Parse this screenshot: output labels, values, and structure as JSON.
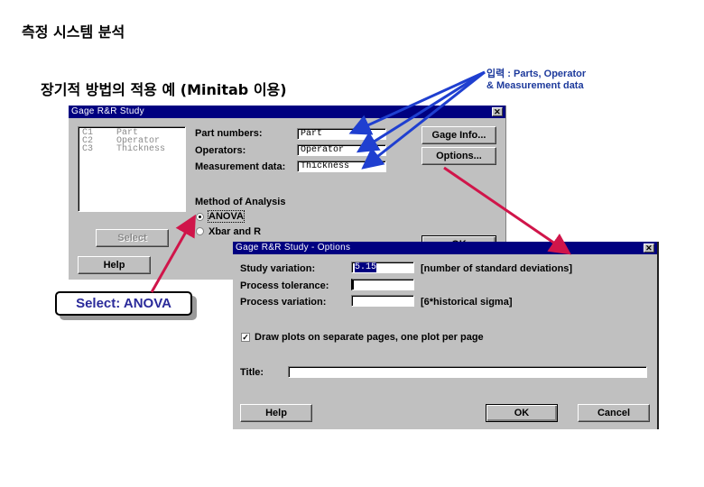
{
  "slide": {
    "title": "측정 시스템 분석",
    "subtitle": "장기적 방법의 적용 예 (Minitab 이용)",
    "note_line1_ko": "입력",
    "note_line1_rest": " : Parts, Operator",
    "note_line2": "& Measurement data",
    "callout": "Select: ANOVA"
  },
  "main_dialog": {
    "title": "Gage R&R Study",
    "columns": [
      {
        "id": "C1",
        "name": "Part"
      },
      {
        "id": "C2",
        "name": "Operator"
      },
      {
        "id": "C3",
        "name": "Thickness"
      }
    ],
    "fields": {
      "part_numbers_label": "Part numbers:",
      "part_numbers_value": "Part",
      "operators_label": "Operators:",
      "operators_value": "Operator",
      "measurement_label": "Measurement data:",
      "measurement_value": "Thickness"
    },
    "method_label": "Method of Analysis",
    "method_options": [
      {
        "label": "ANOVA",
        "selected": true
      },
      {
        "label": "Xbar and R",
        "selected": false
      }
    ],
    "buttons": {
      "gage_info": "Gage Info...",
      "options": "Options...",
      "select": "Select",
      "help": "Help",
      "ok": "OK"
    }
  },
  "options_dialog": {
    "title": "Gage R&R Study - Options",
    "study_variation_label": "Study variation:",
    "study_variation_value": "5.15",
    "study_variation_hint": "[number of standard deviations]",
    "process_tolerance_label": "Process tolerance:",
    "process_tolerance_value": "",
    "process_variation_label": "Process variation:",
    "process_variation_value": "",
    "process_variation_hint": "[6*historical sigma]",
    "draw_plots_label": "Draw plots on separate pages, one plot per page",
    "draw_plots_checked": true,
    "title_label": "Title:",
    "title_value": "",
    "buttons": {
      "help": "Help",
      "ok": "OK",
      "cancel": "Cancel"
    }
  },
  "colors": {
    "titlebar": "#000080",
    "dialog_bg": "#c0c0c0",
    "blue_arrow": "#1f3fd0",
    "red_arrow": "#d0154a",
    "callout_text": "#2a2a9a"
  }
}
